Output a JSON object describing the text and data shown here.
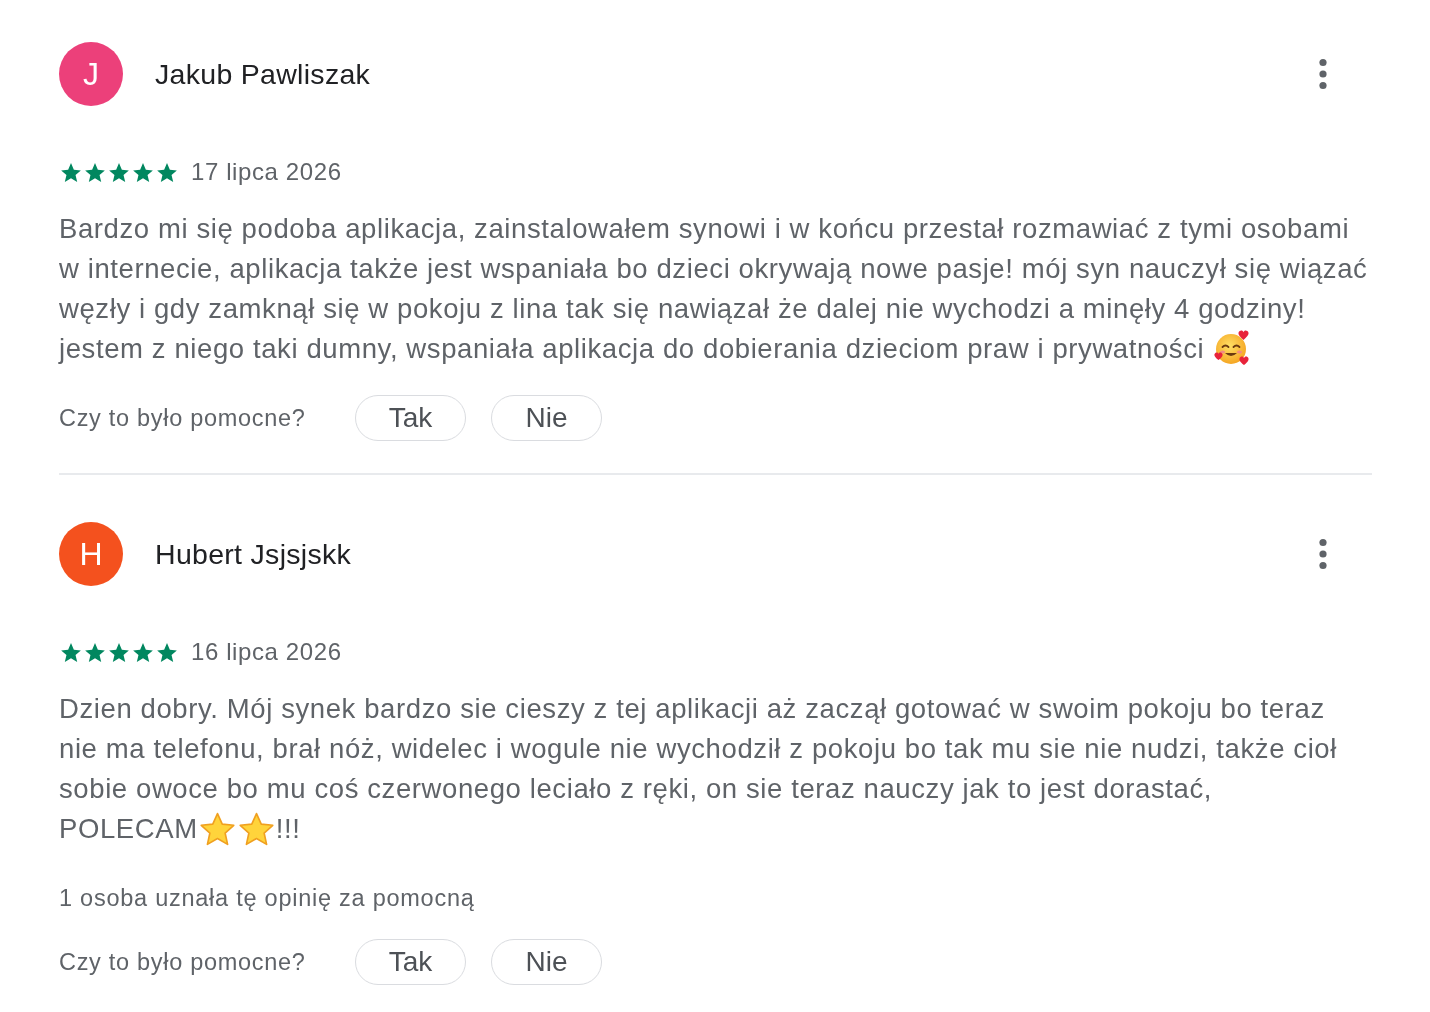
{
  "reviews": [
    {
      "avatar": {
        "initial": "J",
        "color": "#ec407a"
      },
      "author": "Jakub Pawliszak",
      "stars": 5,
      "date": "17 lipca 2026",
      "body": [
        {
          "kind": "text",
          "text": "Bardzo mi się podoba aplikacja, zainstalowałem synowi i w końcu przestał rozmawiać z tymi osobami\nw internecie, aplikacja także jest wspaniała bo dzieci okrywają nowe pasje! mój syn nauczył się wiązać\nwęzły i gdy zamknął się w pokoju z lina tak się nawiązał że dalej nie wychodzi a minęły 4 godziny!\njestem z niego taki dumny, wspaniała aplikacja do dobierania dzieciom praw i prywatności"
        },
        {
          "kind": "hearts"
        }
      ],
      "helpful_prompt": "Czy to było pomocne?",
      "helpful_buttons": [
        "Tak",
        "Nie"
      ]
    },
    {
      "avatar": {
        "initial": "H",
        "color": "#f4511e"
      },
      "author": "Hubert Jsjsjskk",
      "stars": 5,
      "date": "16 lipca 2026",
      "body": [
        {
          "kind": "text",
          "text": "Dzien dobry. Mój synek bardzo sie cieszy z tej aplikacji aż zaczął gotować w swoim pokoju bo teraz\nnie ma telefonu, brał nóż, widelec i wogule nie wychodził z pokoju bo tak mu sie nie nudzi, także cioł\nsobie owoce bo mu coś czerwonego leciało z ręki, on sie teraz nauczy jak to jest dorastać,\nPOLECAM"
        },
        {
          "kind": "star"
        },
        {
          "kind": "star"
        },
        {
          "kind": "text",
          "text": "!!!"
        }
      ],
      "helpful_count": "1 osoba uznała tę opinię za pomocną",
      "helpful_prompt": "Czy to było pomocne?",
      "helpful_buttons": [
        "Tak",
        "Nie"
      ]
    }
  ]
}
